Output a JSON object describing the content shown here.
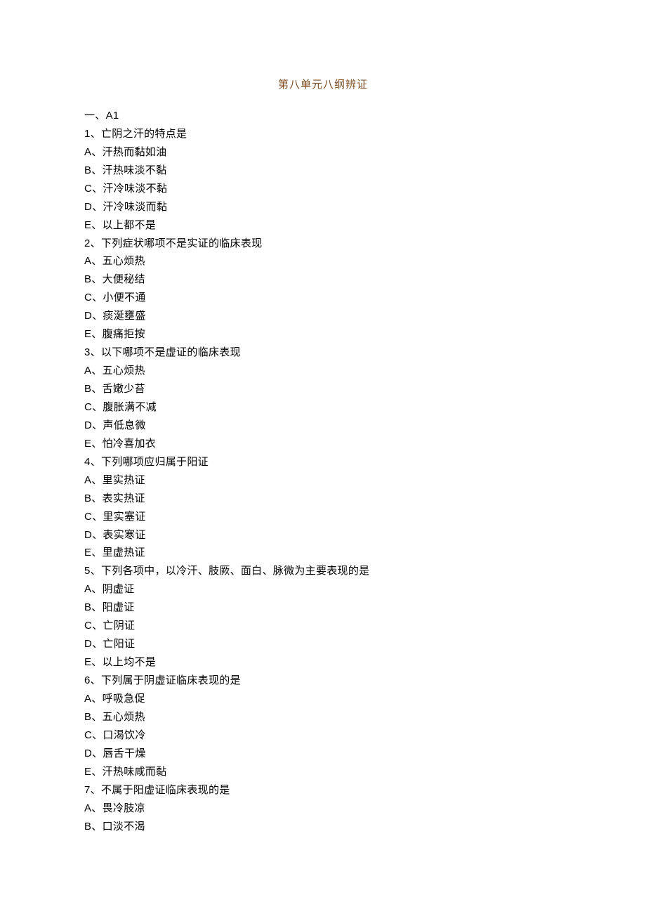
{
  "title": "第八单元八纲辨证",
  "section": "一、A1",
  "questions": [
    {
      "stem": "1、亡阴之汗的特点是",
      "options": [
        "A、汗热而黏如油",
        "B、汗热味淡不黏",
        "C、汗冷味淡不黏",
        "D、汗冷味淡而黏",
        "E、以上都不是"
      ]
    },
    {
      "stem": "2、下列症状哪项不是实证的临床表现",
      "options": [
        "A、五心烦热",
        "B、大便秘结",
        "C、小便不通",
        "D、痰涎壅盛",
        "E、腹痛拒按"
      ]
    },
    {
      "stem": "3、以下哪项不是虚证的临床表现",
      "options": [
        "A、五心烦热",
        "B、舌嫩少苔",
        "C、腹胀满不减",
        "D、声低息微",
        "E、怕冷喜加衣"
      ]
    },
    {
      "stem": "4、下列哪项应归属于阳证",
      "options": [
        "A、里实热证",
        "B、表实热证",
        "C、里实塞证",
        "D、表实寒证",
        "E、里虚热证"
      ]
    },
    {
      "stem": "5、下列各项中，以冷汗、肢厥、面白、脉微为主要表现的是",
      "options": [
        "A、阴虚证",
        "B、阳虚证",
        "C、亡阴证",
        "D、亡阳证",
        "E、以上均不是"
      ]
    },
    {
      "stem": "6、下列属于阴虚证临床表现的是",
      "options": [
        "A、呼吸急促",
        "B、五心烦热",
        "C、口渴饮冷",
        "D、唇舌干燥",
        "E、汗热味咸而黏"
      ]
    },
    {
      "stem": "7、不属于阳虚证临床表现的是",
      "options": [
        "A、畏冷肢凉",
        "B、口淡不渴"
      ]
    }
  ]
}
